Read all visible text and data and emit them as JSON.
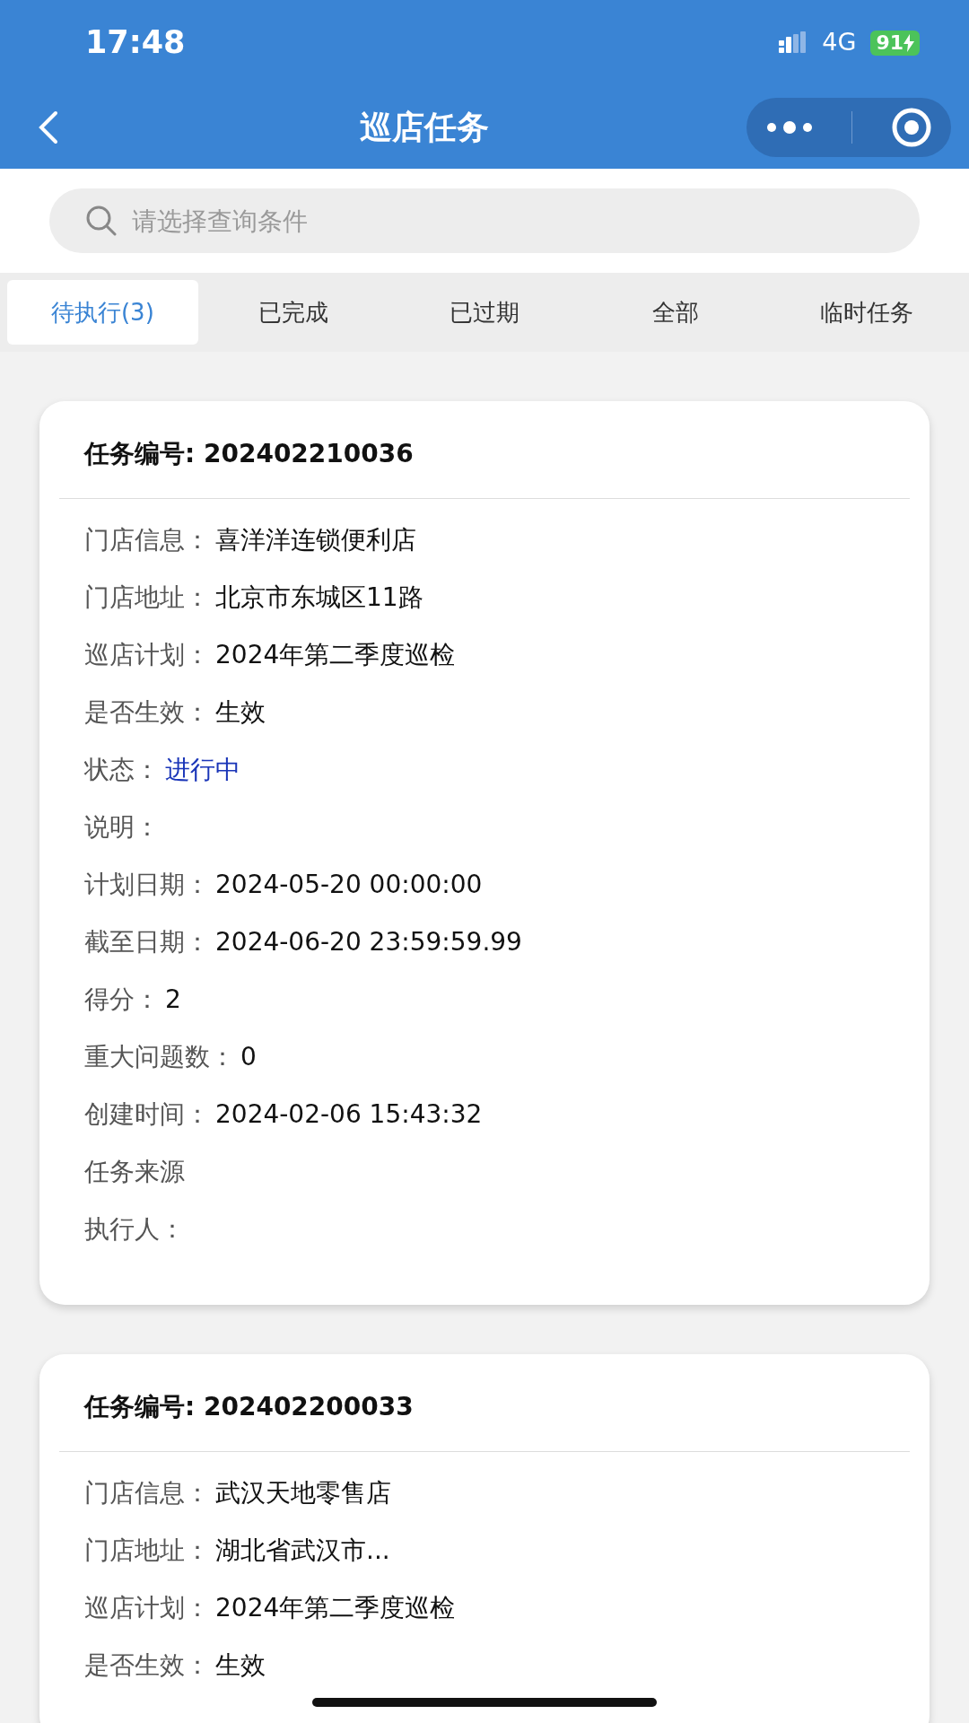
{
  "status_bar": {
    "time": "17:48",
    "network": "4G",
    "battery": "91"
  },
  "nav": {
    "title": "巡店任务"
  },
  "search": {
    "placeholder": "请选择查询条件"
  },
  "tabs": [
    {
      "label": "待执行(3)",
      "selected": true
    },
    {
      "label": "已完成",
      "selected": false
    },
    {
      "label": "已过期",
      "selected": false
    },
    {
      "label": "全部",
      "selected": false
    },
    {
      "label": "临时任务",
      "selected": false
    }
  ],
  "tasks": [
    {
      "title": "任务编号: 202402210036",
      "fields": [
        {
          "label": "门店信息：",
          "value": "喜洋洋连锁便利店",
          "kind": "plain"
        },
        {
          "label": "门店地址：",
          "value": "北京市东城区11路",
          "kind": "plain"
        },
        {
          "label": "巡店计划：",
          "value": "2024年第二季度巡检",
          "kind": "plain"
        },
        {
          "label": "是否生效：",
          "value": "生效",
          "kind": "plain"
        },
        {
          "label": "状态：",
          "value": "进行中",
          "kind": "status"
        },
        {
          "label": "说明：",
          "kind": "plain"
        },
        {
          "label": "计划日期：",
          "value": "2024-05-20 00:00:00",
          "kind": "plain"
        },
        {
          "label": "截至日期：",
          "value": "2024-06-20 23:59:59.99",
          "kind": "plain"
        },
        {
          "label": "得分：",
          "value": "2",
          "kind": "plain"
        },
        {
          "label": "重大问题数：",
          "value": "0",
          "kind": "plain"
        },
        {
          "label": "创建时间：",
          "value": "2024-02-06 15:43:32",
          "kind": "plain"
        },
        {
          "label": "任务来源",
          "kind": "plain"
        },
        {
          "label": "执行人：",
          "kind": "plain"
        }
      ]
    },
    {
      "title": "任务编号: 202402200033",
      "fields": [
        {
          "label": "门店信息：",
          "value": "武汉天地零售店",
          "kind": "plain"
        },
        {
          "label": "门店地址：",
          "value": "湖北省武汉市...",
          "kind": "plain"
        },
        {
          "label": "巡店计划：",
          "value": "2024年第二季度巡检",
          "kind": "plain"
        },
        {
          "label": "是否生效：",
          "value": "生效",
          "kind": "plain"
        }
      ]
    }
  ]
}
